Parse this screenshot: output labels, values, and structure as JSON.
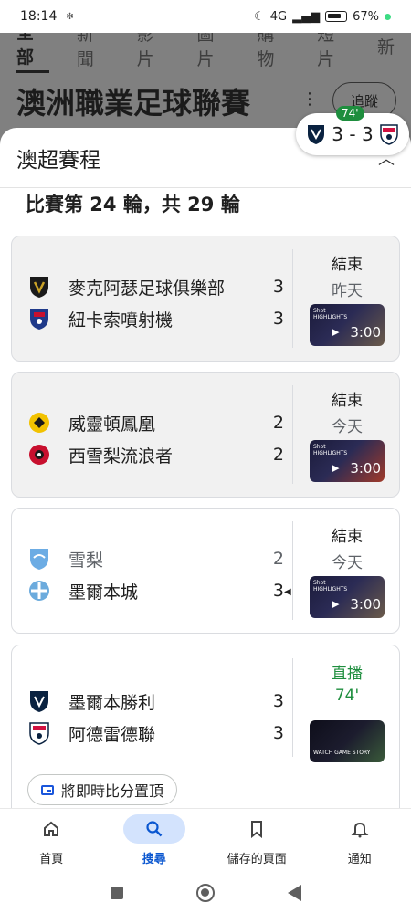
{
  "status_bar": {
    "time": "18:14",
    "network": "4G",
    "battery": "67%"
  },
  "background_page": {
    "tabs": [
      "全部",
      "新聞",
      "影片",
      "圖片",
      "購物",
      "短片",
      "新"
    ],
    "title": "澳洲職業足球聯賽",
    "follow_label": "追蹤"
  },
  "live_chip": {
    "minute": "74'",
    "score": "3 - 3"
  },
  "sheet": {
    "title": "澳超賽程",
    "round_label": "比賽第 24 輪，共 29 輪"
  },
  "matches": [
    {
      "home": {
        "name": "麥克阿瑟足球俱樂部",
        "score": "3",
        "crest": "macarthur-crest",
        "color": "#1a1a1a"
      },
      "away": {
        "name": "紐卡索噴射機",
        "score": "3",
        "crest": "newcastle-crest",
        "color": "#1f3a8a"
      },
      "status": "結束",
      "date": "昨天",
      "video_duration": "3:00"
    },
    {
      "home": {
        "name": "威靈頓鳳凰",
        "score": "2",
        "crest": "wellington-crest",
        "color": "#f2c200"
      },
      "away": {
        "name": "西雪梨流浪者",
        "score": "2",
        "crest": "wsw-crest",
        "color": "#c8102e"
      },
      "status": "結束",
      "date": "今天",
      "video_duration": "3:00"
    },
    {
      "home": {
        "name": "雪梨",
        "score": "2",
        "crest": "sydney-crest",
        "color": "#6cace4"
      },
      "away": {
        "name": "墨爾本城",
        "score": "3",
        "crest": "melbourne-city-crest",
        "color": "#6cabdd"
      },
      "status": "結束",
      "date": "今天",
      "video_duration": "3:00"
    },
    {
      "home": {
        "name": "墨爾本勝利",
        "score": "3",
        "crest": "melbourne-victory-crest",
        "color": "#0a2240"
      },
      "away": {
        "name": "阿德雷德聯",
        "score": "3",
        "crest": "adelaide-crest",
        "color": "#d11241"
      },
      "status": "直播",
      "date": "74'",
      "video_caption": "WATCH GAME STORY"
    }
  ],
  "pin_button": {
    "label": "將即時比分置頂"
  },
  "bottom_nav": {
    "items": [
      {
        "label": "首頁",
        "icon": "home-icon"
      },
      {
        "label": "搜尋",
        "icon": "search-icon"
      },
      {
        "label": "儲存的頁面",
        "icon": "bookmark-icon"
      },
      {
        "label": "通知",
        "icon": "bell-icon"
      }
    ],
    "active_index": 1
  },
  "colors": {
    "accent": "#0b57d0",
    "live_green": "#1e8e3e",
    "nav_active_bg": "#d3e3fd"
  }
}
